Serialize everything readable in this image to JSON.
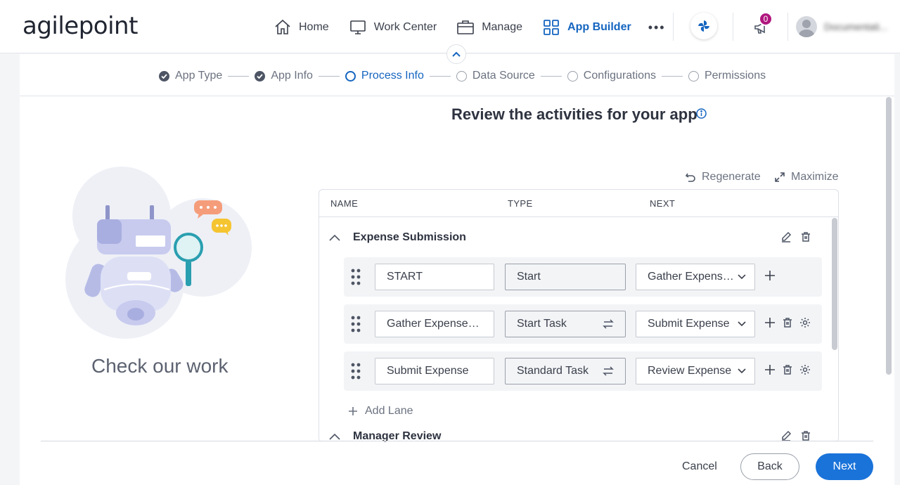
{
  "logo": "agilepoint",
  "nav": {
    "items": [
      {
        "label": "Home",
        "icon": "home-icon"
      },
      {
        "label": "Work Center",
        "icon": "monitor-icon"
      },
      {
        "label": "Manage",
        "icon": "briefcase-icon"
      },
      {
        "label": "App Builder",
        "icon": "grid-icon",
        "active": true
      }
    ],
    "more": "•••",
    "notification_count": "0",
    "user_name": "Documentati..."
  },
  "stepper": [
    {
      "label": "App Type",
      "state": "done"
    },
    {
      "label": "App Info",
      "state": "done"
    },
    {
      "label": "Process Info",
      "state": "current"
    },
    {
      "label": "Data Source",
      "state": "todo"
    },
    {
      "label": "Configurations",
      "state": "todo"
    },
    {
      "label": "Permissions",
      "state": "todo"
    }
  ],
  "title": "Review the activities for your app",
  "illustration_caption": "Check our work",
  "actions": {
    "regenerate": "Regenerate",
    "maximize": "Maximize"
  },
  "table": {
    "columns": [
      "NAME",
      "TYPE",
      "NEXT"
    ],
    "lanes": [
      {
        "name": "Expense Submission",
        "rows": [
          {
            "name": "START",
            "type": "Start",
            "next": "Gather Expense..."
          },
          {
            "name": "Gather Expense Det",
            "type": "Start Task",
            "next": "Submit Expense"
          },
          {
            "name": "Submit Expense",
            "type": "Standard Task",
            "next": "Review Expense"
          }
        ]
      },
      {
        "name": "Manager Review",
        "rows": []
      }
    ],
    "add_lane": "Add Lane"
  },
  "footer": {
    "cancel": "Cancel",
    "back": "Back",
    "next": "Next"
  },
  "colors": {
    "accent": "#1565c0",
    "primary_button": "#1a73d9",
    "badge": "#b0177e"
  }
}
